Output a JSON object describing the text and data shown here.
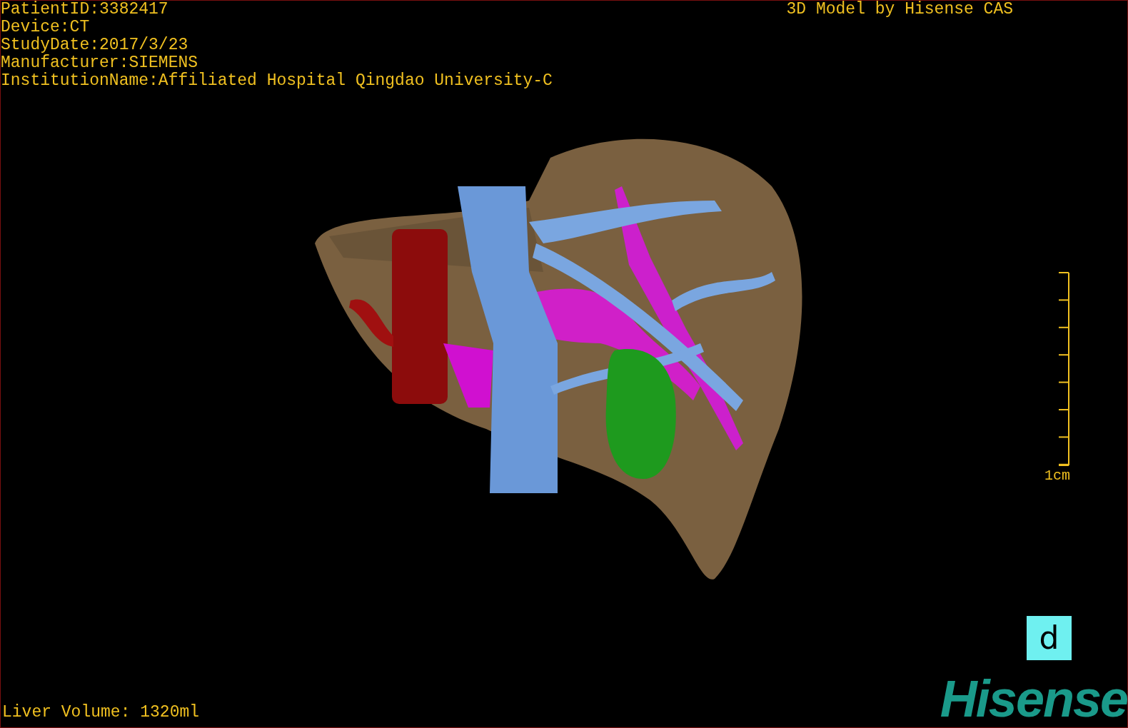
{
  "overlay": {
    "info_lines": [
      "PatientID:3382417",
      "Device:CT",
      "StudyDate:2017/3/23",
      "Manufacturer:SIEMENS",
      "InstitutionName:Affiliated Hospital Qingdao University-C"
    ],
    "title": "3D Model by Hisense CAS"
  },
  "scale_bar": {
    "label": "1cm"
  },
  "footer": {
    "volume": "Liver Volume: 1320ml",
    "view_badge": "d",
    "logo": "Hisense"
  }
}
